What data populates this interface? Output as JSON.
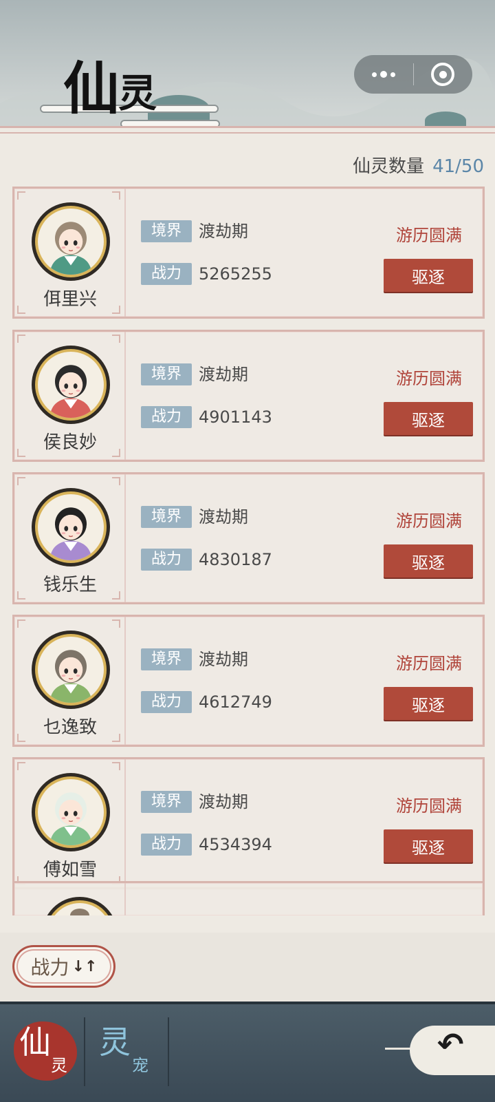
{
  "header": {
    "title_big": "仙",
    "title_small": "灵"
  },
  "capsule": {
    "more_icon": "more-dots-icon",
    "close_icon": "target-close-icon"
  },
  "count": {
    "label": "仙灵数量",
    "value": "41/50"
  },
  "labels": {
    "realm": "境界",
    "power": "战力",
    "expel": "驱逐"
  },
  "characters": [
    {
      "name": "佴里兴",
      "realm": "渡劫期",
      "power": "5265255",
      "status": "游历圆满",
      "hair": "#9c8a76",
      "robe": "#4f9a85"
    },
    {
      "name": "侯良妙",
      "realm": "渡劫期",
      "power": "4901143",
      "status": "游历圆满",
      "hair": "#2b2b2b",
      "robe": "#d9615b"
    },
    {
      "name": "钱乐生",
      "realm": "渡劫期",
      "power": "4830187",
      "status": "游历圆满",
      "hair": "#232323",
      "robe": "#a88bd0"
    },
    {
      "name": "乜逸致",
      "realm": "渡劫期",
      "power": "4612749",
      "status": "游历圆满",
      "hair": "#7d7468",
      "robe": "#8ab56a"
    },
    {
      "name": "傅如雪",
      "realm": "渡劫期",
      "power": "4534394",
      "status": "游历圆满",
      "hair": "#e6efe7",
      "robe": "#7fc08c"
    }
  ],
  "sort": {
    "label": "战力",
    "arrows": "↓↑"
  },
  "tabs": [
    {
      "big": "仙",
      "small": "灵",
      "active": true
    },
    {
      "big": "灵",
      "small": "宠",
      "active": false
    }
  ],
  "back": {
    "icon": "back-arrow-icon",
    "glyph": "↶"
  }
}
